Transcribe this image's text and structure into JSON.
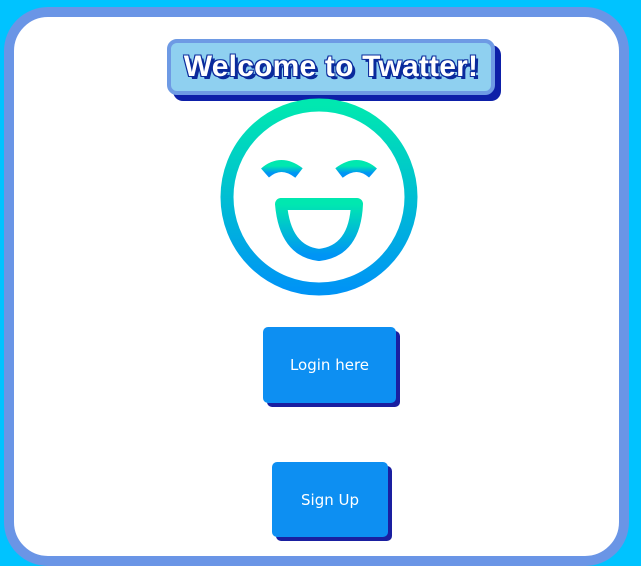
{
  "header": {
    "title": "Welcome to Twatter!"
  },
  "logo": {
    "icon": "smiley-face-icon",
    "gradient_top": "#00e8b0",
    "gradient_bottom": "#0094f5"
  },
  "buttons": {
    "login_label": "Login here",
    "signup_label": "Sign Up"
  },
  "colors": {
    "page_background": "#00c3ff",
    "frame_border": "#6a95e6",
    "button_fill": "#0d8ff2",
    "button_shadow": "#1a1fa0"
  }
}
